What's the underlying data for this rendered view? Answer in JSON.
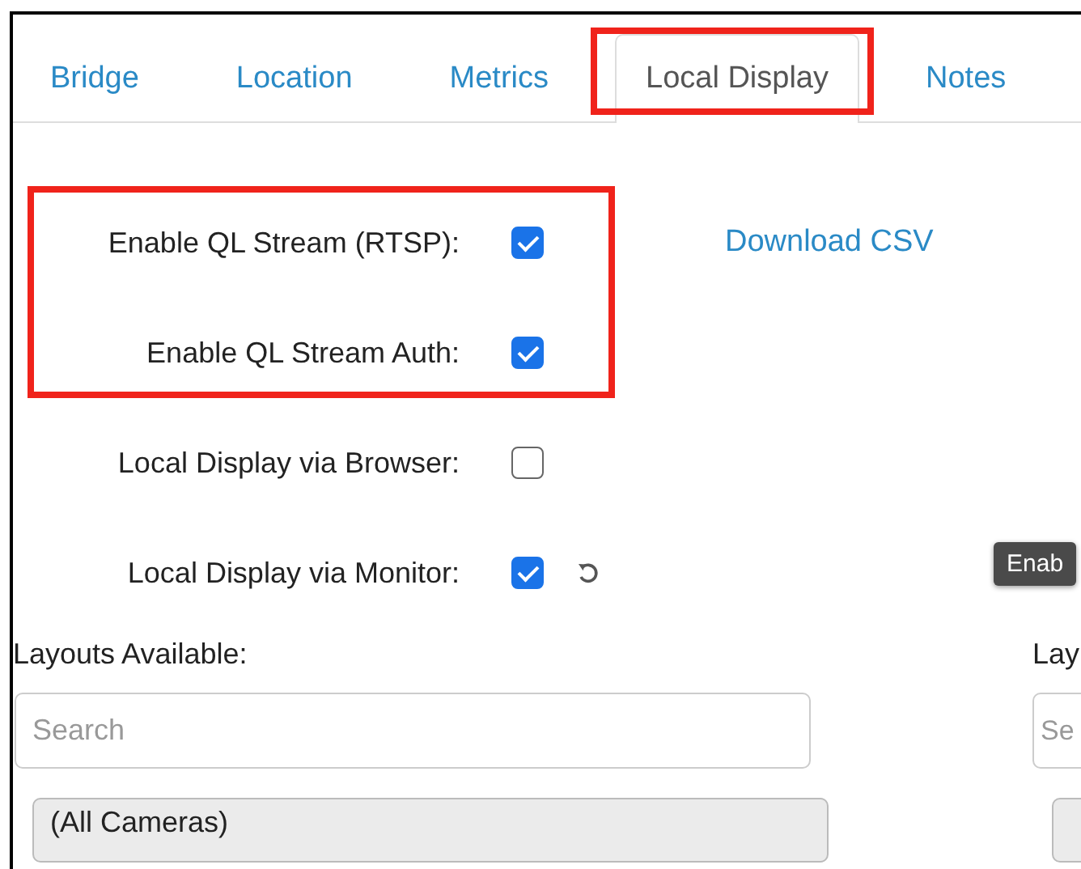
{
  "tabs": [
    {
      "label": "Bridge",
      "selected": false
    },
    {
      "label": "Location",
      "selected": false
    },
    {
      "label": "Metrics",
      "selected": false
    },
    {
      "label": "Local Display",
      "selected": true
    },
    {
      "label": "Notes",
      "selected": false
    }
  ],
  "settings": [
    {
      "label": "Enable QL Stream (RTSP):",
      "checked": true,
      "reset": false
    },
    {
      "label": "Enable QL Stream Auth:",
      "checked": true,
      "reset": false
    },
    {
      "label": "Local Display via Browser:",
      "checked": false,
      "reset": false
    },
    {
      "label": "Local Display via Monitor:",
      "checked": true,
      "reset": true
    }
  ],
  "download_link": "Download CSV",
  "tooltip": "Enab",
  "layouts_available": {
    "label": "Layouts Available:",
    "placeholder": "Search",
    "items": [
      "(All Cameras)"
    ]
  },
  "layouts_right": {
    "label": "Lay",
    "placeholder": "Se"
  }
}
